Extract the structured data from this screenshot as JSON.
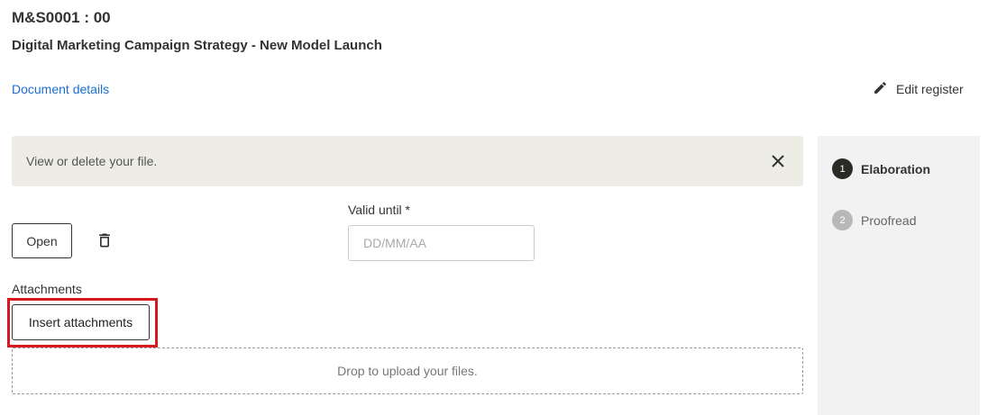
{
  "header": {
    "doc_code": "M&S0001 : 00",
    "doc_title": "Digital Marketing Campaign Strategy - New Model Launch",
    "document_details_link": "Document details",
    "edit_register_label": "Edit register"
  },
  "banner": {
    "message": "View or delete your file."
  },
  "file_actions": {
    "open_label": "Open"
  },
  "valid_until": {
    "label": "Valid until *",
    "value": "",
    "placeholder": "DD/MM/AA"
  },
  "attachments": {
    "label": "Attachments",
    "insert_label": "Insert attachments",
    "drop_text": "Drop to upload your files."
  },
  "steps": [
    {
      "number": "1",
      "label": "Elaboration",
      "state": "active"
    },
    {
      "number": "2",
      "label": "Proofread",
      "state": "pending"
    }
  ],
  "colors": {
    "link": "#1a6fd1",
    "highlight": "#d7191f",
    "banner_bg": "#edede6",
    "steps_panel_bg": "#f2f2f2",
    "active_step": "#2b2b26",
    "pending_step": "#b8b8b8"
  },
  "icons": {
    "edit": "pencil-icon",
    "close": "close-icon",
    "delete": "trash-icon"
  }
}
